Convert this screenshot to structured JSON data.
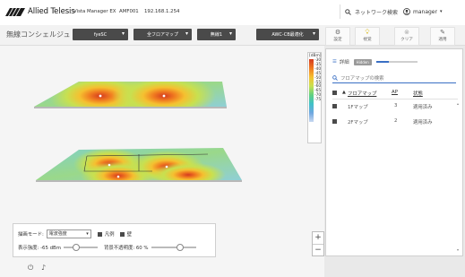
{
  "header": {
    "brand": "Allied Telesis",
    "product": "Vista Manager EX",
    "module": "AMF001",
    "ip": "192.168.1.254",
    "search_placeholder": "ネットワーク検索",
    "user": "manager"
  },
  "toolbar": {
    "title": "無線コンシェルジュ",
    "dropdowns": [
      "fyeSC",
      "全フロアマップ",
      "無線1",
      "AWC-CB最適化"
    ],
    "buttons": [
      {
        "label": "設定",
        "icon": "gear-icon"
      },
      {
        "label": "視覚",
        "icon": "lightbulb-icon"
      },
      {
        "label": "クリア",
        "icon": "clear-icon"
      },
      {
        "label": "適用",
        "icon": "wrench-icon"
      }
    ]
  },
  "legend": {
    "unit": "[dBm]",
    "values": [
      "-30",
      "-35",
      "-40",
      "-45",
      "-50",
      "-55",
      "-60",
      "-65",
      "-70",
      "-75"
    ]
  },
  "panel": {
    "detail_label": "詳細",
    "toggle_label": "Hidden",
    "search_placeholder": "フロアマップの検索",
    "columns": [
      "フロアマップ",
      "AP",
      "状態"
    ],
    "rows": [
      {
        "name": "1Fマップ",
        "ap": "3",
        "status": "適用済み",
        "checked": true
      },
      {
        "name": "2Fマップ",
        "ap": "2",
        "status": "適用済み",
        "checked": true
      }
    ]
  },
  "controls": {
    "mode_label": "描画モード:",
    "mode_value": "電波強度",
    "cb1_label": "凡例",
    "cb2_label": "壁",
    "strength_label": "表示強度: -65 dBm",
    "opacity_label": "背景不透明度: 60 %"
  },
  "zoom": {
    "in": "+",
    "out": "−"
  },
  "bottom": {
    "icons": [
      "power-icon",
      "bell-icon"
    ]
  }
}
